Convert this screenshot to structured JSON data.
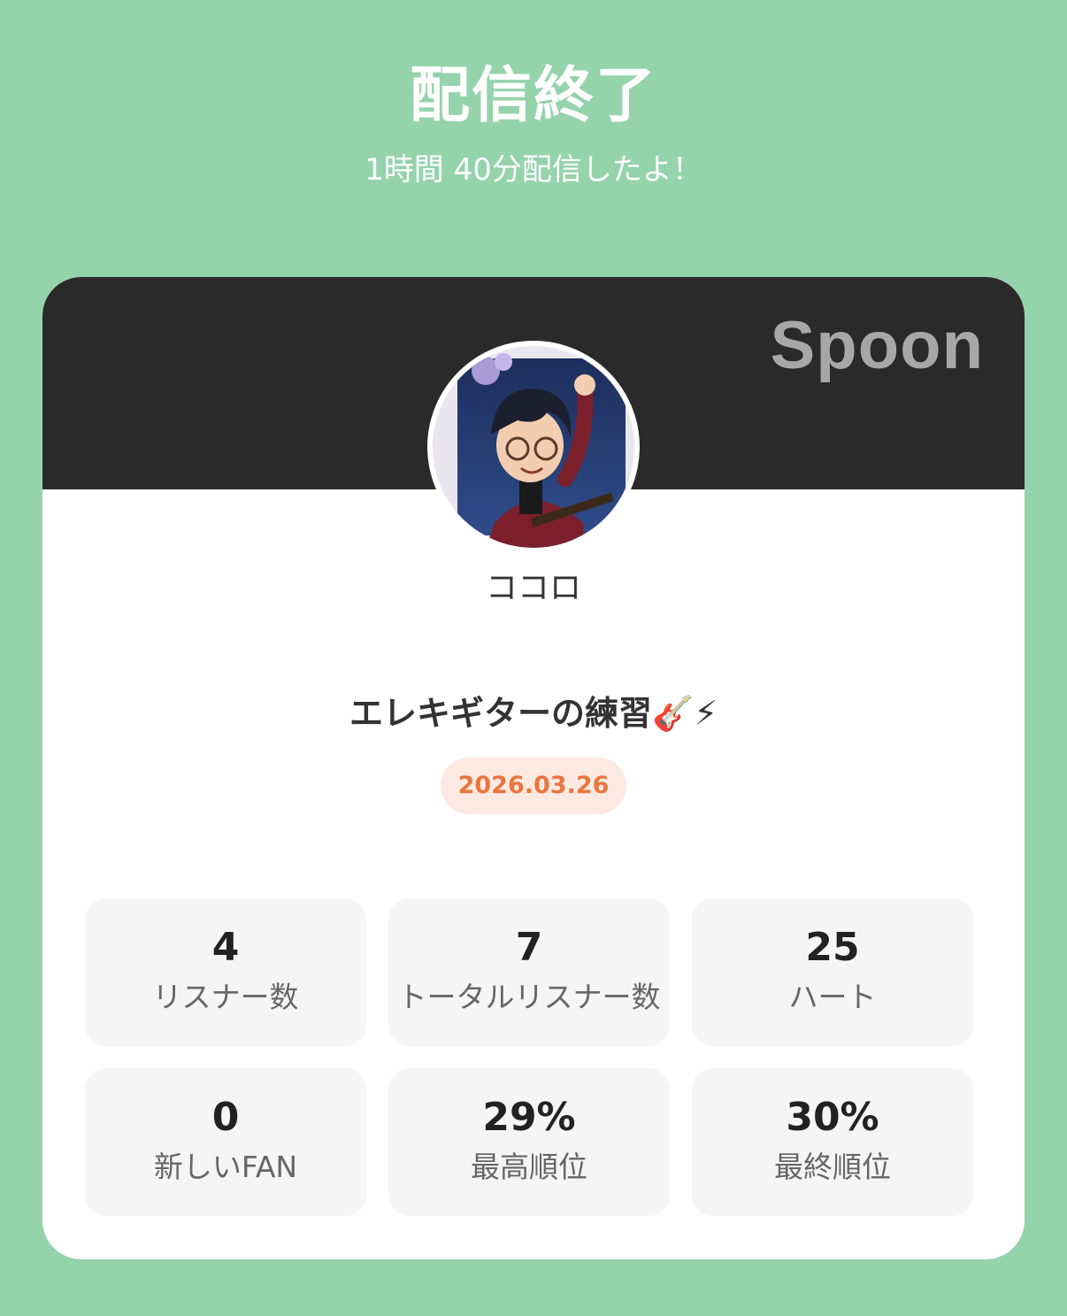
{
  "header": {
    "title": "配信終了",
    "subtitle": "1時間 40分配信したよ！"
  },
  "card": {
    "brand": "Spoon",
    "username": "ココロ",
    "stream_title": "エレキギターの練習🎸⚡",
    "date": "2026.03.26"
  },
  "stats": [
    {
      "value": "4",
      "label": "リスナー数"
    },
    {
      "value": "7",
      "label": "トータルリスナー数"
    },
    {
      "value": "25",
      "label": "ハート"
    },
    {
      "value": "0",
      "label": "新しいFAN"
    },
    {
      "value": "29%",
      "label": "最高順位"
    },
    {
      "value": "30%",
      "label": "最終順位"
    }
  ],
  "colors": {
    "background": "#95d3ab",
    "banner": "#2a2a2a",
    "date_text": "#e8763e",
    "date_badge": "#fce9e1",
    "tile": "#f5f5f5"
  }
}
